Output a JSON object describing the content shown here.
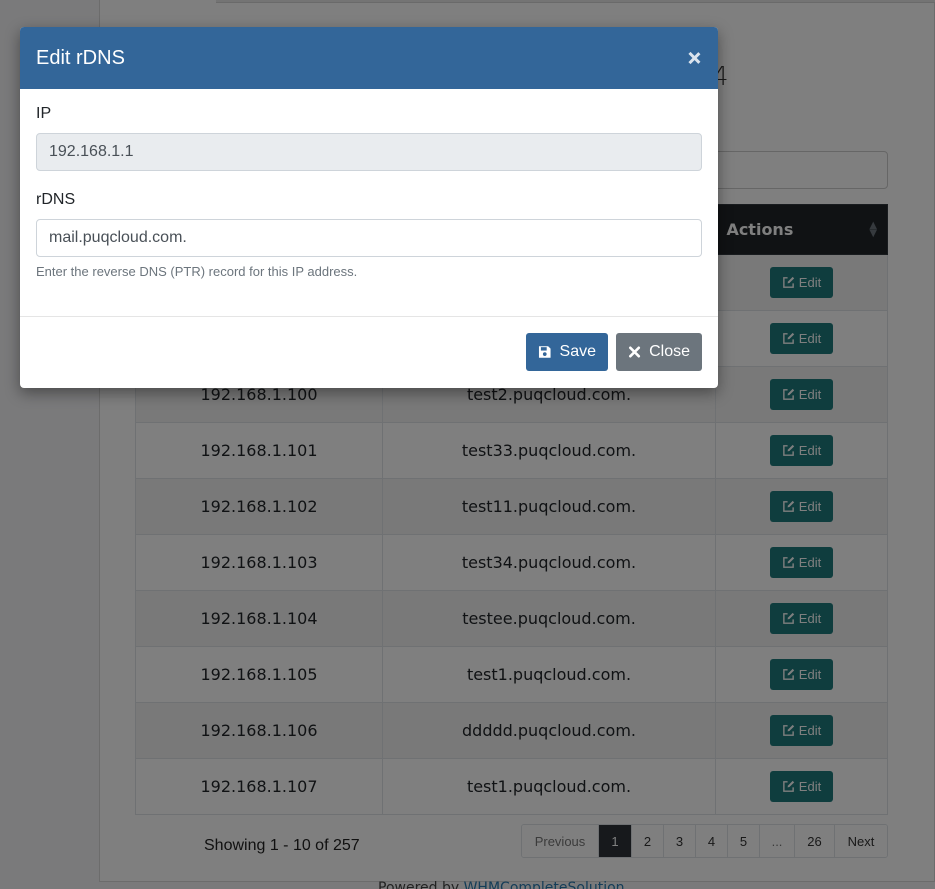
{
  "background": {
    "heading_tail": "4",
    "table": {
      "headers": {
        "actions": "Actions"
      },
      "rows": [
        {
          "ip": "",
          "rdns": "",
          "action": "Edit"
        },
        {
          "ip": "",
          "rdns": "",
          "action": "Edit"
        },
        {
          "ip": "192.168.1.100",
          "rdns": "test2.puqcloud.com.",
          "action": "Edit"
        },
        {
          "ip": "192.168.1.101",
          "rdns": "test33.puqcloud.com.",
          "action": "Edit"
        },
        {
          "ip": "192.168.1.102",
          "rdns": "test11.puqcloud.com.",
          "action": "Edit"
        },
        {
          "ip": "192.168.1.103",
          "rdns": "test34.puqcloud.com.",
          "action": "Edit"
        },
        {
          "ip": "192.168.1.104",
          "rdns": "testee.puqcloud.com.",
          "action": "Edit"
        },
        {
          "ip": "192.168.1.105",
          "rdns": "test1.puqcloud.com.",
          "action": "Edit"
        },
        {
          "ip": "192.168.1.106",
          "rdns": "ddddd.puqcloud.com.",
          "action": "Edit"
        },
        {
          "ip": "192.168.1.107",
          "rdns": "test1.puqcloud.com.",
          "action": "Edit"
        }
      ]
    },
    "showing": "Showing 1 - 10 of 257",
    "pagination": {
      "previous": "Previous",
      "pages": [
        "1",
        "2",
        "3",
        "4",
        "5",
        "...",
        "26"
      ],
      "active": "1",
      "next": "Next"
    },
    "footer": {
      "prefix": "Powered by ",
      "link": "WHMCompleteSolution"
    }
  },
  "modal": {
    "title": "Edit rDNS",
    "ip_label": "IP",
    "ip_value": "192.168.1.1",
    "rdns_label": "rDNS",
    "rdns_value": "mail.puqcloud.com.",
    "help_text": "Enter the reverse DNS (PTR) record for this IP address.",
    "save_label": "Save",
    "close_label": "Close"
  },
  "colors": {
    "modal_header": "#336699",
    "edit_button": "#1f7b7c",
    "table_header": "#212529",
    "close_button": "#6c757d"
  }
}
